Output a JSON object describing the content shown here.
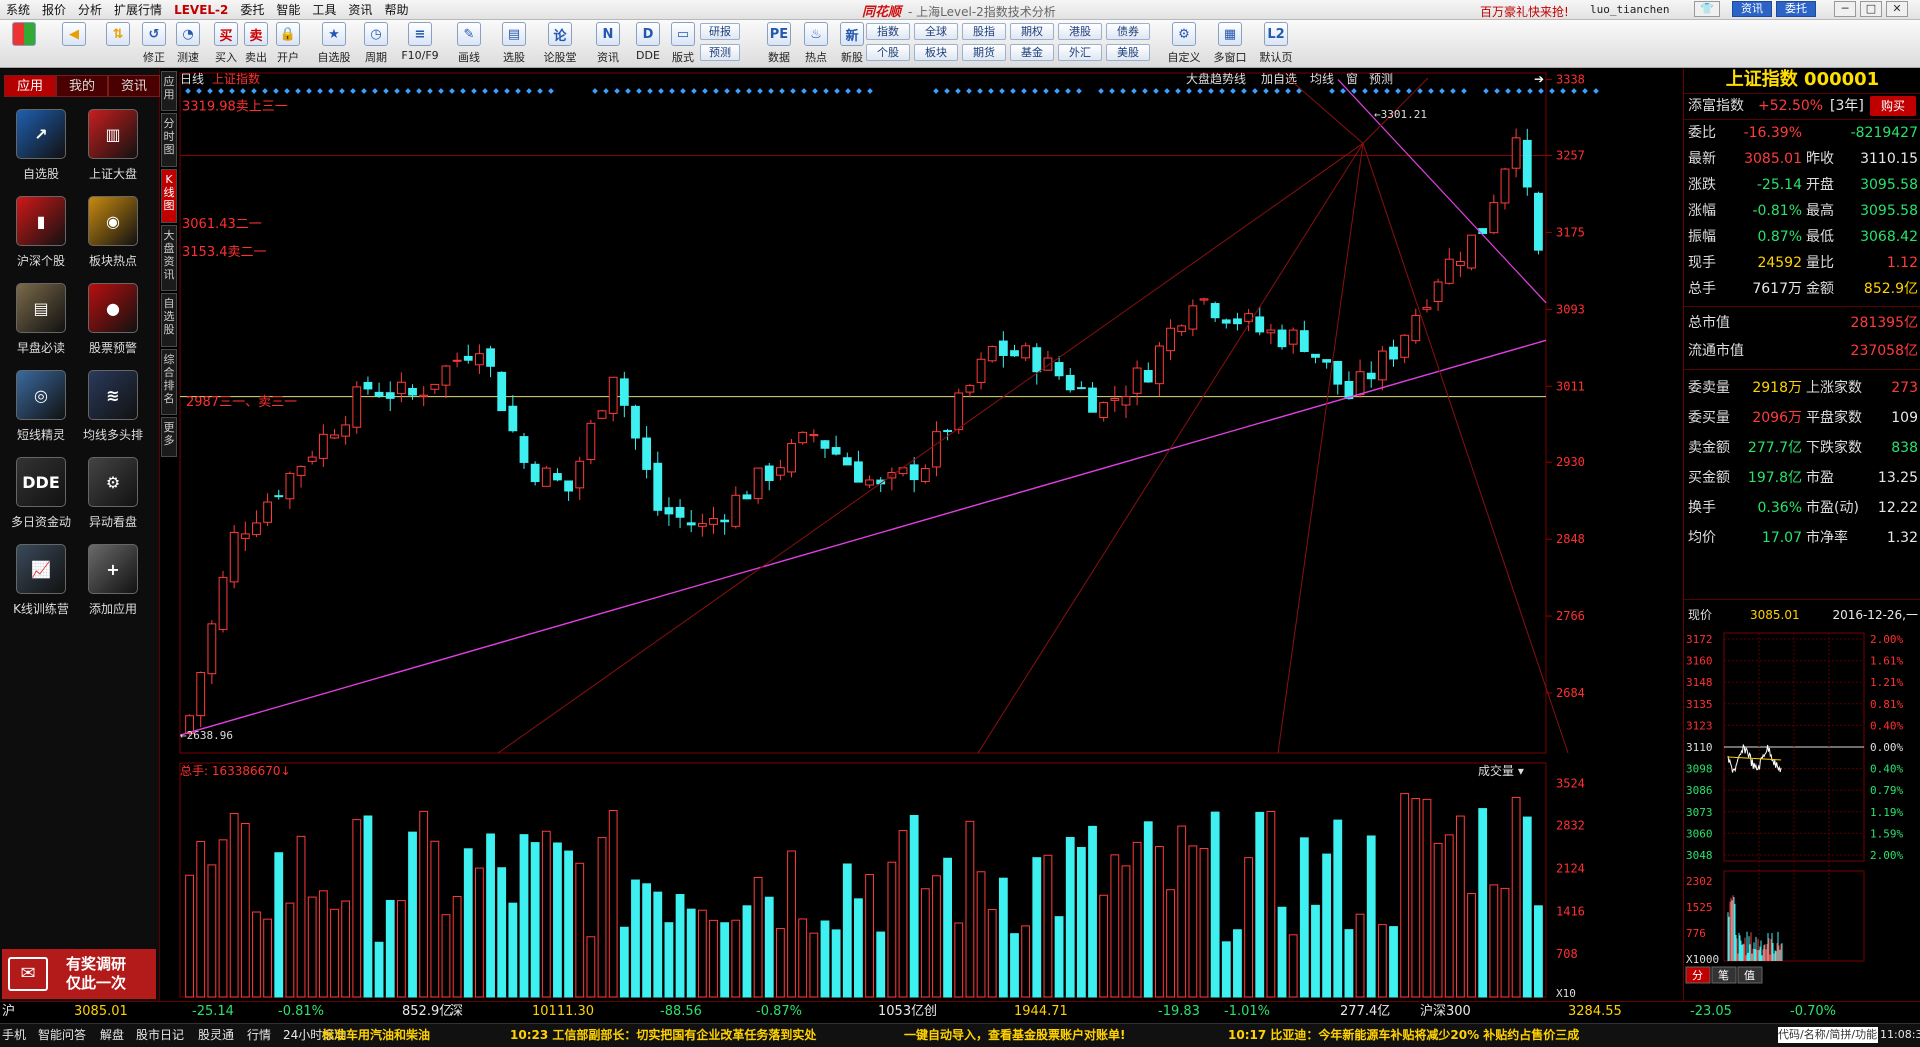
{
  "menu": [
    "系统",
    "报价",
    "分析",
    "扩展行情",
    "LEVEL-2",
    "委托",
    "智能",
    "工具",
    "资讯",
    "帮助"
  ],
  "window": {
    "brand": "同花顺",
    "title": "- 上海Level-2指数技术分析",
    "promo": "百万豪礼快来抢!",
    "user": "luo_tianchen",
    "news_btn": "资讯",
    "trade_btn": "委托"
  },
  "toolbar": {
    "buttons": [
      {
        "id": "correct",
        "label": "修正",
        "icon": "↺"
      },
      {
        "id": "test",
        "label": "测速",
        "icon": "◔"
      },
      {
        "id": "buy",
        "label": "买入",
        "icon": "买"
      },
      {
        "id": "sell",
        "label": "卖出",
        "icon": "卖"
      },
      {
        "id": "open",
        "label": "开户",
        "icon": "🔒"
      },
      {
        "id": "watchlist",
        "label": "自选股",
        "icon": "★"
      },
      {
        "id": "period",
        "label": "周期",
        "icon": "◷"
      },
      {
        "id": "f10",
        "label": "F10/F9",
        "icon": "≡"
      },
      {
        "id": "draw",
        "label": "画线",
        "icon": "✎"
      },
      {
        "id": "pick",
        "label": "选股",
        "icon": "▤"
      },
      {
        "id": "forum",
        "label": "论股堂",
        "icon": "论"
      },
      {
        "id": "news",
        "label": "资讯",
        "icon": "N"
      },
      {
        "id": "dde",
        "label": "DDE",
        "icon": "D"
      },
      {
        "id": "layout",
        "label": "版式",
        "icon": "▭"
      },
      {
        "id": "data",
        "label": "数据",
        "icon": "PE"
      },
      {
        "id": "hot",
        "label": "热点",
        "icon": "♨"
      },
      {
        "id": "newstock",
        "label": "新股",
        "icon": "新"
      },
      {
        "id": "custom",
        "label": "自定义",
        "icon": "⚙"
      },
      {
        "id": "multiwin",
        "label": "多窗口",
        "icon": "▦"
      },
      {
        "id": "default",
        "label": "默认页",
        "icon": "L2"
      }
    ],
    "small": [
      "研报",
      "预测",
      "指数",
      "全球",
      "股指",
      "期权",
      "港股",
      "债券",
      "个股",
      "板块",
      "期货",
      "基金",
      "外汇",
      "美股"
    ]
  },
  "left": {
    "tabs": [
      "应用",
      "我的",
      "资讯"
    ],
    "apps": [
      {
        "name": "自选股",
        "icon": "chart-up-icon",
        "color": "#1f5fb0"
      },
      {
        "name": "上证大盘",
        "icon": "monitor-chart-icon",
        "color": "#c71f1f"
      },
      {
        "name": "沪深个股",
        "icon": "bar-chart-icon",
        "color": "#d01818"
      },
      {
        "name": "板块热点",
        "icon": "radar-icon",
        "color": "#c88a10"
      },
      {
        "name": "早盘必读",
        "icon": "newspaper-icon",
        "color": "#7a6a4a"
      },
      {
        "name": "股票预警",
        "icon": "alarm-icon",
        "color": "#b80f0f"
      },
      {
        "name": "短线精灵",
        "icon": "elf-icon",
        "color": "#3a6aa0"
      },
      {
        "name": "均线多头排",
        "icon": "ma-lines-icon",
        "color": "#2a3a5a"
      },
      {
        "name": "多日资金动",
        "icon": "dde-icon",
        "color": "#333333"
      },
      {
        "name": "异动看盘",
        "icon": "gear-icon",
        "color": "#444444"
      },
      {
        "name": "K线训练营",
        "icon": "kline-icon",
        "color": "#3a4a5a"
      },
      {
        "name": "添加应用",
        "icon": "plus-icon",
        "color": "#6a6a6a"
      }
    ],
    "survey": "有奖调研\n仅此一次"
  },
  "vtabs": [
    "应用",
    "分时图",
    "K线图",
    "大盘资讯",
    "自选股",
    "综合排名",
    "更多"
  ],
  "chart": {
    "period": "日线",
    "name": "上证指数",
    "toolbar": [
      "大盘趋势线",
      "加自选",
      "均线",
      "窗",
      "预测"
    ],
    "vol_label": "总手: 163386670",
    "vol_dropdown": "成交量",
    "annotations": [
      {
        "text": "3319.98卖上三一",
        "color": "#ff3030"
      },
      {
        "text": "3061.43二一",
        "color": "#ff3030"
      },
      {
        "text": "3153.4卖二一",
        "color": "#ff3030"
      },
      {
        "text": "2987三一、卖三一",
        "color": "#ff3030"
      }
    ],
    "high_mark": "3301.21",
    "low_mark": "2638.96"
  },
  "chart_data": {
    "type": "candlestick",
    "title": "上证指数 日线",
    "y_ticks": [
      3338,
      3257,
      3175,
      3093,
      3011,
      2930,
      2848,
      2766,
      2684
    ],
    "ylim": [
      2620,
      3345
    ],
    "vol_ticks": [
      3524,
      2832,
      2124,
      1416,
      708
    ],
    "vol_unit": "X10",
    "high": 3301.21,
    "low": 2638.96,
    "volume_total": 163386670
  },
  "quote": {
    "title": "上证指数 000001",
    "tianfu": {
      "label": "添富指数",
      "value": "+52.50%",
      "tag": "[3年]",
      "buy": "购买"
    },
    "rows": [
      {
        "k": "委比",
        "v": "-16.39%",
        "vc": "red",
        "k2": "",
        "v2": "-8219427",
        "v2c": "green"
      },
      {
        "k": "最新",
        "v": "3085.01",
        "vc": "red",
        "k2": "昨收",
        "v2": "3110.15",
        "v2c": "white"
      },
      {
        "k": "涨跌",
        "v": "-25.14",
        "vc": "green",
        "k2": "开盘",
        "v2": "3095.58",
        "v2c": "green"
      },
      {
        "k": "涨幅",
        "v": "-0.81%",
        "vc": "green",
        "k2": "最高",
        "v2": "3095.58",
        "v2c": "green"
      },
      {
        "k": "振幅",
        "v": "0.87%",
        "vc": "green",
        "k2": "最低",
        "v2": "3068.42",
        "v2c": "green"
      },
      {
        "k": "现手",
        "v": "24592",
        "vc": "yel",
        "k2": "量比",
        "v2": "1.12",
        "v2c": "red"
      },
      {
        "k": "总手",
        "v": "7617万",
        "vc": "white",
        "k2": "金额",
        "v2": "852.9亿",
        "v2c": "yel"
      }
    ],
    "caps": [
      {
        "k": "总市值",
        "v": "281395亿"
      },
      {
        "k": "流通市值",
        "v": "237058亿"
      }
    ],
    "stats": [
      {
        "k": "委卖量",
        "v": "2918万",
        "vc": "yel",
        "k2": "上涨家数",
        "v2": "273",
        "v2c": "red"
      },
      {
        "k": "委买量",
        "v": "2096万",
        "vc": "red",
        "k2": "平盘家数",
        "v2": "109",
        "v2c": "white"
      },
      {
        "k": "卖金额",
        "v": "277.7亿",
        "vc": "green",
        "k2": "下跌家数",
        "v2": "838",
        "v2c": "green"
      },
      {
        "k": "买金额",
        "v": "197.8亿",
        "vc": "green",
        "k2": "市盈",
        "v2": "13.25",
        "v2c": "white"
      },
      {
        "k": "换手",
        "v": "0.36%",
        "vc": "green",
        "k2": "市盈(动)",
        "v2": "12.22",
        "v2c": "white"
      },
      {
        "k": "均价",
        "v": "17.07",
        "vc": "green",
        "k2": "市净率",
        "v2": "1.32",
        "v2c": "white"
      }
    ],
    "price_line": {
      "k": "现价",
      "v": "3085.01",
      "date": "2016-12-26,一"
    },
    "mini_left": [
      "3172",
      "3160",
      "3148",
      "3135",
      "3123",
      "3110",
      "3098",
      "3086",
      "3073",
      "3060",
      "3048"
    ],
    "mini_right": [
      "2.00%",
      "1.61%",
      "1.21%",
      "0.81%",
      "0.40%",
      "0.00%",
      "0.40%",
      "0.79%",
      "1.19%",
      "1.59%",
      "2.00%"
    ],
    "mini_vol": [
      "2302",
      "1525",
      "776",
      "X1000"
    ],
    "mini_tabs": [
      "分",
      "笔",
      "值"
    ]
  },
  "status": {
    "items": [
      {
        "t": "沪",
        "c": "white"
      },
      {
        "t": "3085.01",
        "c": "yel"
      },
      {
        "t": "-25.14",
        "c": "green"
      },
      {
        "t": "-0.81%",
        "c": "green"
      },
      {
        "t": "852.9亿",
        "c": "white"
      },
      {
        "t": "深",
        "c": "white"
      },
      {
        "t": "10111.30",
        "c": "yel"
      },
      {
        "t": "-88.56",
        "c": "green"
      },
      {
        "t": "-0.87%",
        "c": "green"
      },
      {
        "t": "1053亿",
        "c": "white"
      },
      {
        "t": "创",
        "c": "white"
      },
      {
        "t": "1944.71",
        "c": "yel"
      },
      {
        "t": "-19.83",
        "c": "green"
      },
      {
        "t": "-1.01%",
        "c": "green"
      },
      {
        "t": "277.4亿",
        "c": "white"
      },
      {
        "t": "沪深300",
        "c": "white"
      },
      {
        "t": "3284.55",
        "c": "yel"
      },
      {
        "t": "-23.05",
        "c": "green"
      },
      {
        "t": "-0.70%",
        "c": "green"
      }
    ]
  },
  "news": {
    "left": [
      "手机",
      "智能问答",
      "解盘",
      "股市日记",
      "股灵通",
      "行情",
      "24小时滚动"
    ],
    "ticker": [
      "标准车用汽油和柴油",
      "10:23 工信部副部长：切实把国有企业改革任务落到实处",
      "一键自动导入，查看基金股票账户对账单!",
      "10:17 比亚迪：今年新能源车补贴将减少20% 补贴约占售价三成"
    ],
    "search": "代码/名称/简拼/功能",
    "time": "11:08:33"
  }
}
